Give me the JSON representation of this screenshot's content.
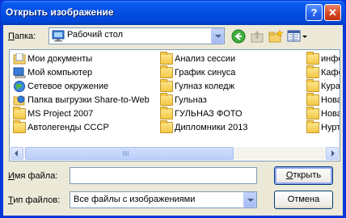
{
  "window": {
    "title": "Открыть изображение",
    "help_glyph": "?",
    "close_glyph": "✕"
  },
  "lookin": {
    "label_pre": "",
    "label_hot": "П",
    "label_post": "апка:",
    "value": "Рабочий стол"
  },
  "toolbar": {
    "icons": [
      "back-icon",
      "up-folder-icon",
      "new-folder-icon",
      "view-menu-icon"
    ]
  },
  "files": [
    {
      "name": "Мои документы",
      "icon": "my-documents-icon"
    },
    {
      "name": "Мой компьютер",
      "icon": "my-computer-icon"
    },
    {
      "name": "Сетевое окружение",
      "icon": "network-places-icon"
    },
    {
      "name": "Папка выгрузки Share-to-Web",
      "icon": "share-to-web-icon"
    },
    {
      "name": "MS Project 2007",
      "icon": "folder-icon"
    },
    {
      "name": "Автолегенды СССР",
      "icon": "folder-icon"
    },
    {
      "name": "Анализ сессии",
      "icon": "folder-icon"
    },
    {
      "name": "График синуса",
      "icon": "folder-icon"
    },
    {
      "name": "Гулназ коледж",
      "icon": "folder-icon"
    },
    {
      "name": "Гульназ",
      "icon": "folder-icon"
    },
    {
      "name": "ГУЛЬНАЗ ФОТО",
      "icon": "folder-icon"
    },
    {
      "name": "Дипломники 2013",
      "icon": "folder-icon"
    },
    {
      "name": "инфо",
      "icon": "folder-icon"
    },
    {
      "name": "Кафе",
      "icon": "folder-icon"
    },
    {
      "name": "Кура",
      "icon": "folder-icon"
    },
    {
      "name": "Нова",
      "icon": "folder-icon"
    },
    {
      "name": "Нова",
      "icon": "folder-icon"
    },
    {
      "name": "Нурт",
      "icon": "folder-icon"
    }
  ],
  "filename": {
    "label_pre": "",
    "label_hot": "И",
    "label_post": "мя файла:",
    "value": ""
  },
  "filetype": {
    "label_pre": "",
    "label_hot": "Т",
    "label_post": "ип файлов:",
    "value": "Все файлы с изображениями"
  },
  "buttons": {
    "open_hot": "О",
    "open_post": "ткрыть",
    "cancel": "Отмена"
  },
  "colors": {
    "titlebar": "#0550e5",
    "dialog_bg": "#ece9d8",
    "field_border": "#7f9db9"
  }
}
